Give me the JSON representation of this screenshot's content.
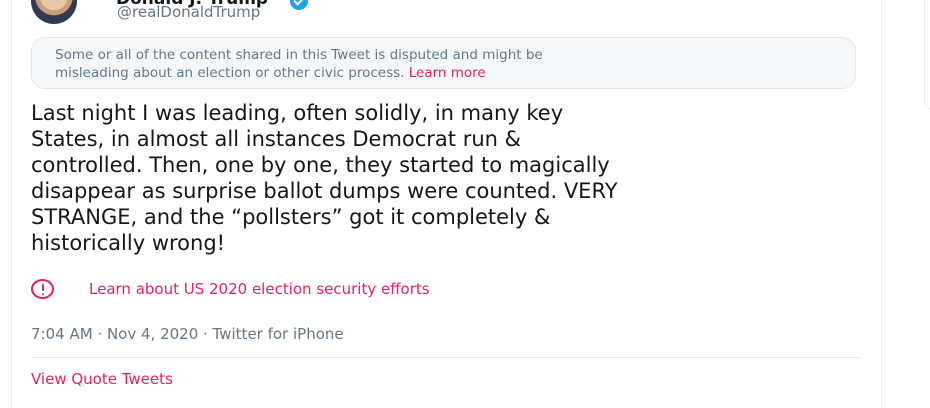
{
  "author": {
    "display_name": "Donald J. Trump",
    "handle": "@realDonaldTrump",
    "verified": true,
    "verified_icon": "verified-badge-icon"
  },
  "notice": {
    "line1": "Some or all of the content shared in this Tweet is disputed and might be",
    "line2": "misleading about an election or other civic process.",
    "learn_more": "Learn more"
  },
  "tweet": {
    "lines": [
      "Last night I was leading, often solidly, in many key",
      "States, in almost all instances Democrat run &",
      "controlled. Then, one by one, they started to magically",
      "disappear as surprise ballot dumps were counted. VERY",
      "STRANGE, and the “pollsters” got it completely &",
      "historically wrong!"
    ]
  },
  "election_link": {
    "icon": "alert-circle-icon",
    "label": "Learn about US 2020 election security efforts"
  },
  "meta": {
    "line": "7:04 AM · Nov 4, 2020 · Twitter for iPhone"
  },
  "actions": {
    "view_quote_tweets": "View Quote Tweets"
  },
  "colors": {
    "accent": "#e0245e",
    "muted": "#657786",
    "verified": "#1da1f2",
    "notice_bg": "#f5f8fa"
  }
}
